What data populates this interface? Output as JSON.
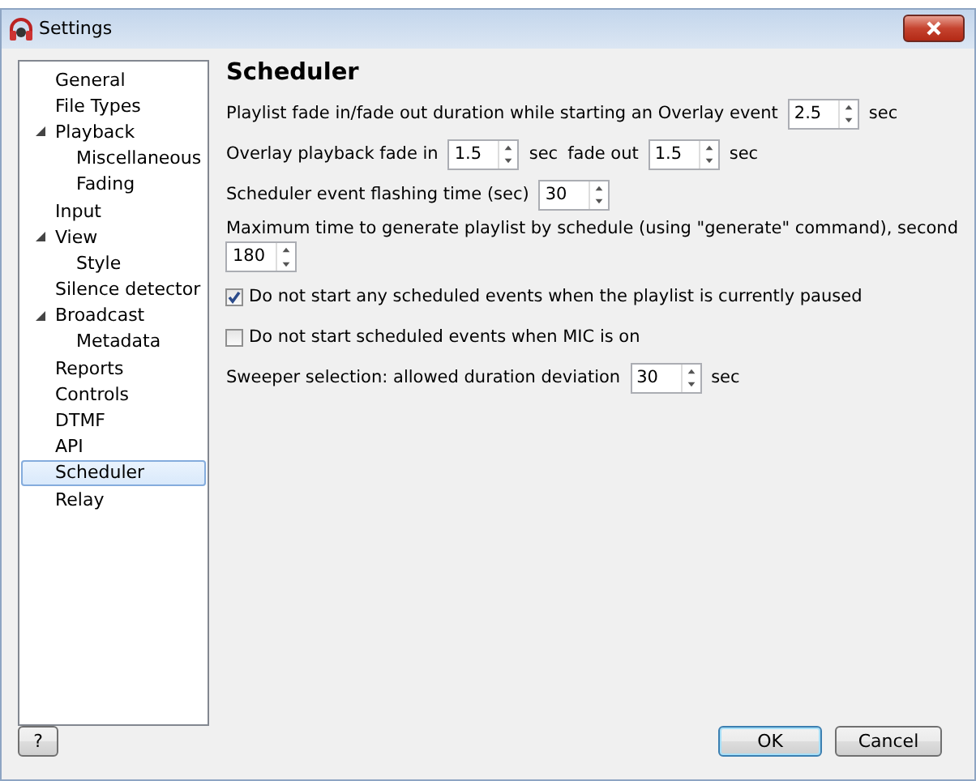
{
  "window": {
    "title": "Settings"
  },
  "sidebar": {
    "items": [
      {
        "label": "General",
        "selected": false
      },
      {
        "label": "File Types",
        "selected": false
      },
      {
        "label": "Playback",
        "selected": false,
        "expanded": true,
        "children": [
          {
            "label": "Miscellaneous",
            "selected": false
          },
          {
            "label": "Fading",
            "selected": false
          }
        ]
      },
      {
        "label": "Input",
        "selected": false
      },
      {
        "label": "View",
        "selected": false,
        "expanded": true,
        "children": [
          {
            "label": "Style",
            "selected": false
          }
        ]
      },
      {
        "label": "Silence detector",
        "selected": false
      },
      {
        "label": "Broadcast",
        "selected": false,
        "expanded": true,
        "children": [
          {
            "label": "Metadata",
            "selected": false
          }
        ]
      },
      {
        "label": "Reports",
        "selected": false
      },
      {
        "label": "Controls",
        "selected": false
      },
      {
        "label": "DTMF",
        "selected": false
      },
      {
        "label": "API",
        "selected": false
      },
      {
        "label": "Scheduler",
        "selected": true
      },
      {
        "label": "Relay",
        "selected": false
      }
    ]
  },
  "panel": {
    "heading": "Scheduler",
    "rows": [
      {
        "kind": "inline",
        "items": [
          {
            "kind": "text",
            "text": "Playlist fade in/fade out duration while starting an Overlay event"
          },
          {
            "kind": "spin",
            "value": "2.5"
          },
          {
            "kind": "text",
            "text": "sec"
          }
        ]
      },
      {
        "kind": "inline",
        "items": [
          {
            "kind": "text",
            "text": "Overlay playback fade in"
          },
          {
            "kind": "spin",
            "value": "1.5"
          },
          {
            "kind": "text",
            "text": "sec"
          },
          {
            "kind": "text",
            "text": "fade out"
          },
          {
            "kind": "spin",
            "value": "1.5"
          },
          {
            "kind": "text",
            "text": "sec"
          }
        ]
      },
      {
        "kind": "inline",
        "items": [
          {
            "kind": "text",
            "text": "Scheduler event flashing time (sec)"
          },
          {
            "kind": "spin",
            "value": "30"
          }
        ]
      },
      {
        "kind": "stacked",
        "label": "Maximum time to generate playlist by schedule (using \"generate\" command), second",
        "value": "180"
      },
      {
        "kind": "checkbox",
        "label": "Do not start any scheduled events when the playlist is currently paused",
        "checked": true
      },
      {
        "kind": "checkbox",
        "label": "Do not start scheduled events when MIC is on",
        "checked": false
      },
      {
        "kind": "inline",
        "items": [
          {
            "kind": "text",
            "text": "Sweeper selection: allowed duration deviation"
          },
          {
            "kind": "spin",
            "value": "30"
          },
          {
            "kind": "text",
            "text": "sec"
          }
        ]
      }
    ]
  },
  "buttons": {
    "help": "?",
    "ok": "OK",
    "cancel": "Cancel"
  }
}
